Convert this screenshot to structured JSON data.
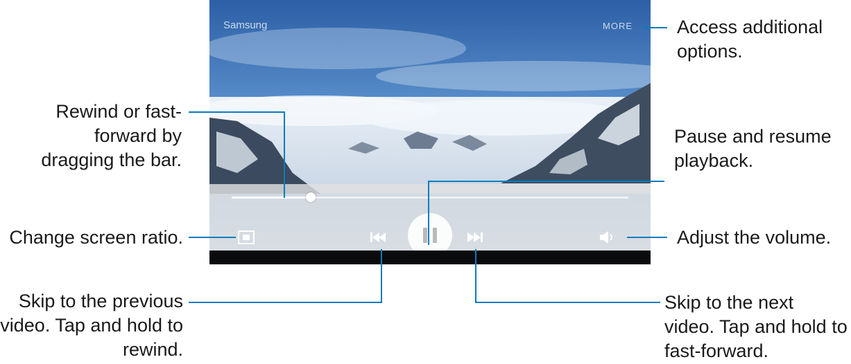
{
  "player": {
    "title": "Samsung",
    "more_label": "MORE",
    "elapsed": "",
    "duration": "",
    "progress_fraction": 0.2,
    "accent_color": "#0a7bbd"
  },
  "callouts": {
    "more_options": "Access additional options.",
    "seek_bar": "Rewind or fast-forward by dragging the bar.",
    "pause_resume": "Pause and resume playback.",
    "screen_ratio": "Change screen ratio.",
    "volume": "Adjust the volume.",
    "previous": "Skip to the previous video. Tap and hold to rewind.",
    "next": "Skip to the next video. Tap and hold to fast-forward."
  },
  "icons": [
    "screen-ratio-icon",
    "previous-icon",
    "pause-icon",
    "next-icon",
    "volume-icon",
    "more-icon"
  ]
}
